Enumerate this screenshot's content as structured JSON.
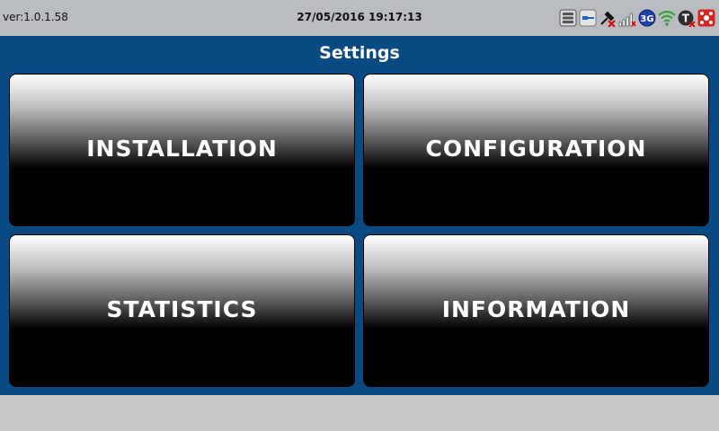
{
  "status_bar": {
    "version": "ver:1.0.1.58",
    "datetime": "27/05/2016 19:17:13",
    "icons": [
      "storage-icon",
      "card-reader-icon",
      "gps-disabled-icon",
      "signal-strength-icon",
      "3g-icon",
      "wifi-icon",
      "tracking-disabled-icon",
      "alarm-icon"
    ],
    "network_label": "3G",
    "tracking_letter": "T"
  },
  "main": {
    "title": "Settings",
    "tiles": [
      {
        "label": "INSTALLATION"
      },
      {
        "label": "CONFIGURATION"
      },
      {
        "label": "STATISTICS"
      },
      {
        "label": "INFORMATION"
      }
    ]
  },
  "colors": {
    "status_bar_bg": "#b9bcc0",
    "panel_bg": "#0a4a82",
    "footer_bg": "#c8c8c8",
    "tile_text": "#ffffff"
  }
}
